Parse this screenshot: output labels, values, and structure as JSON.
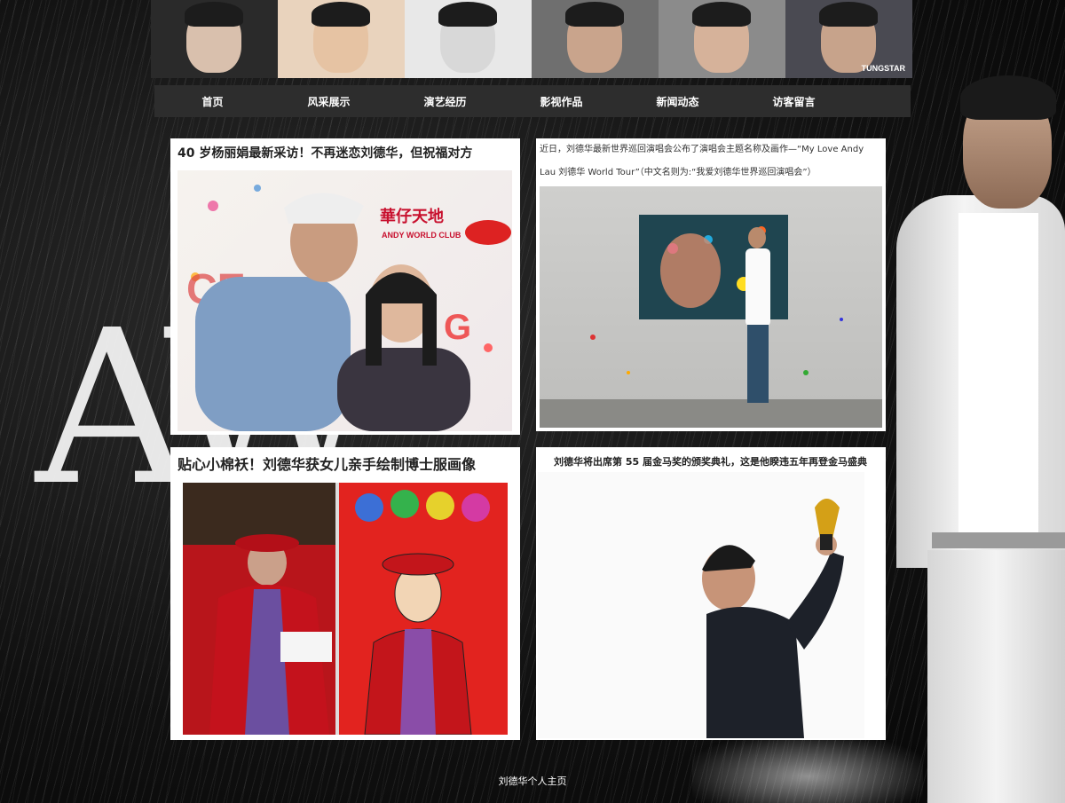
{
  "background": {
    "big_text": "AW"
  },
  "header": {
    "photos": [
      {
        "name": "portrait-1",
        "bg": "#2a2a2a",
        "skin": "#d9c0ad"
      },
      {
        "name": "portrait-2",
        "bg": "#e9d3bd",
        "skin": "#e6c3a3"
      },
      {
        "name": "portrait-3",
        "bg": "#e8e8e8",
        "skin": "#d8d8d8"
      },
      {
        "name": "portrait-4",
        "bg": "#6f6f6f",
        "skin": "#c9a48c"
      },
      {
        "name": "portrait-5",
        "bg": "#8b8b8b",
        "skin": "#d6b29a"
      },
      {
        "name": "portrait-6",
        "bg": "#4a4a52",
        "skin": "#c7a38b",
        "logo": "TUNGSTAR"
      }
    ]
  },
  "nav": {
    "items": [
      "首页",
      "风采展示",
      "演艺经历",
      "影视作品",
      "新闻动态",
      "访客留言"
    ]
  },
  "cards": {
    "c1": {
      "title": "40 岁杨丽娟最新采访！不再迷恋刘德华，但祝福对方",
      "sign1": "華仔天地",
      "sign2": "ANDY WORLD CLUB"
    },
    "c2": {
      "text": "近日，刘德华最新世界巡回演唱会公布了演唱会主题名称及画作—“My Love Andy Lau 刘德华 World Tour”（中文名则为:“我爱刘德华世界巡回演唱会”）"
    },
    "c3": {
      "title": "贴心小棉袄！刘德华获女儿亲手绘制博士服画像"
    },
    "c4": {
      "title": "刘德华将出席第 55 届金马奖的颁奖典礼，这是他睽违五年再登金马盛典"
    }
  },
  "footer": {
    "text": "刘德华个人主页"
  }
}
